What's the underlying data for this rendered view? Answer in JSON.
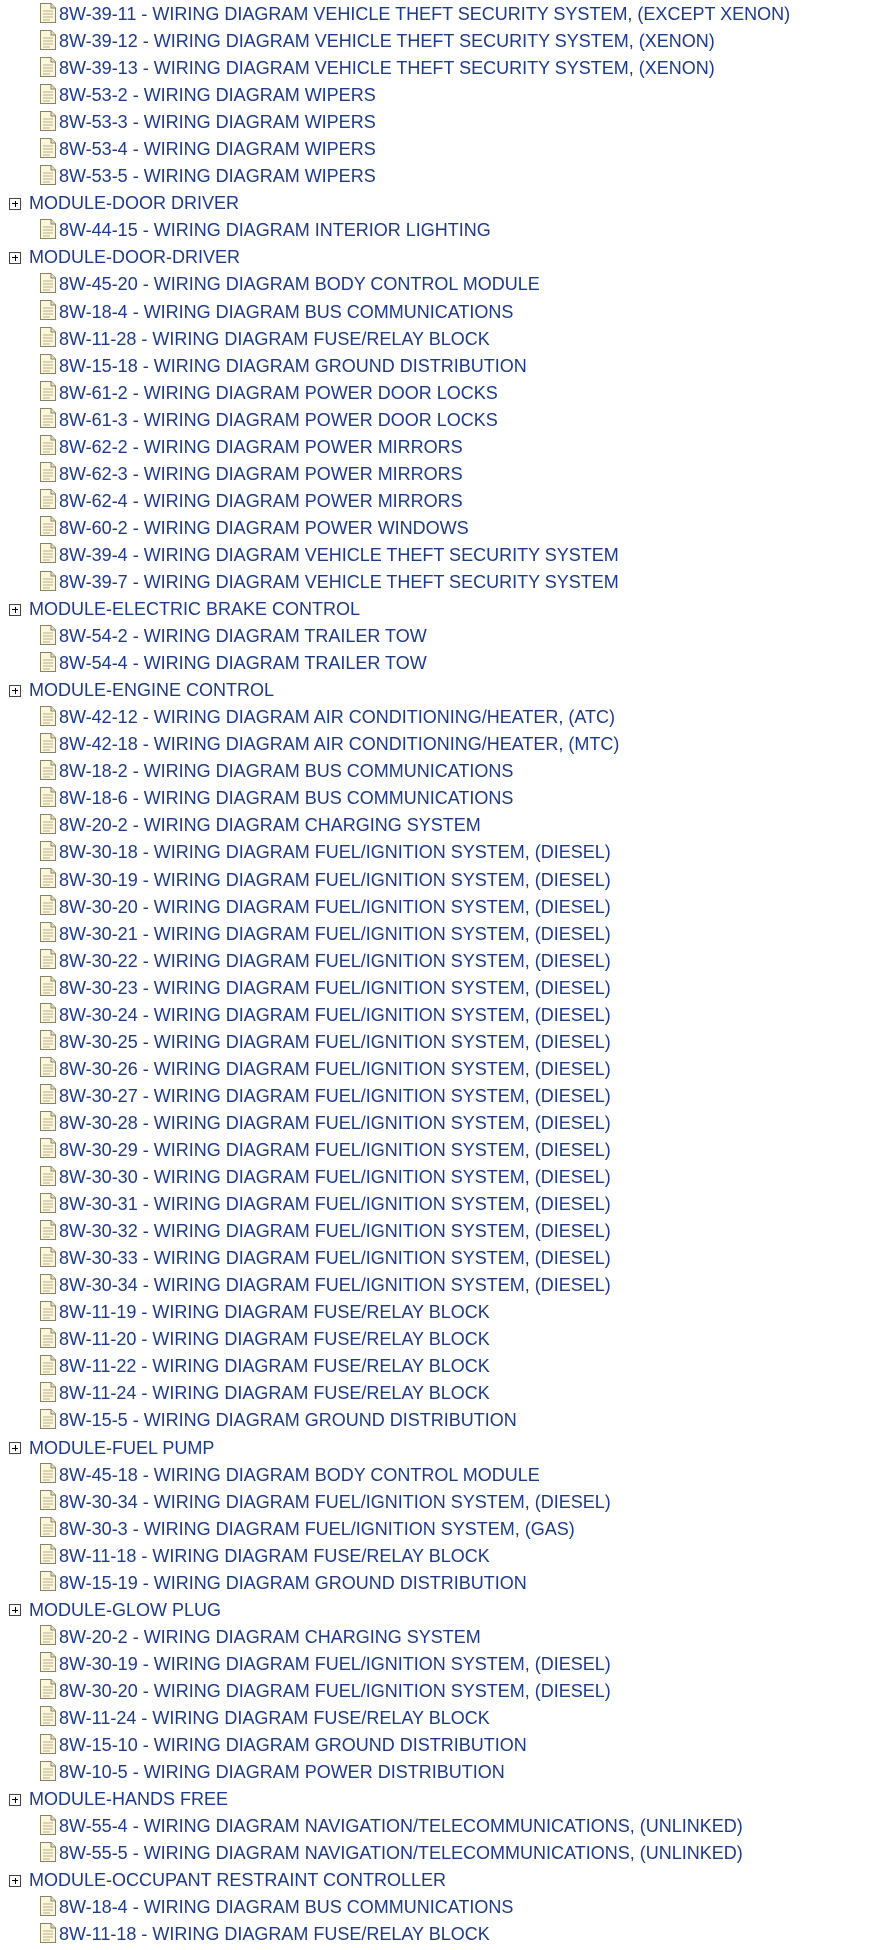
{
  "tree": [
    {
      "type": "item",
      "label": "8W-39-11 - WIRING DIAGRAM VEHICLE THEFT SECURITY SYSTEM, (EXCEPT XENON)"
    },
    {
      "type": "item",
      "label": "8W-39-12 - WIRING DIAGRAM VEHICLE THEFT SECURITY SYSTEM, (XENON)"
    },
    {
      "type": "item",
      "label": "8W-39-13 - WIRING DIAGRAM VEHICLE THEFT SECURITY SYSTEM, (XENON)"
    },
    {
      "type": "item",
      "label": "8W-53-2 - WIRING DIAGRAM WIPERS"
    },
    {
      "type": "item",
      "label": "8W-53-3 - WIRING DIAGRAM WIPERS"
    },
    {
      "type": "item",
      "label": "8W-53-4 - WIRING DIAGRAM WIPERS"
    },
    {
      "type": "item",
      "label": "8W-53-5 - WIRING DIAGRAM WIPERS"
    },
    {
      "type": "group",
      "label": "MODULE-DOOR DRIVER"
    },
    {
      "type": "item",
      "label": "8W-44-15 - WIRING DIAGRAM INTERIOR LIGHTING"
    },
    {
      "type": "group",
      "label": "MODULE-DOOR-DRIVER"
    },
    {
      "type": "item",
      "label": "8W-45-20 - WIRING DIAGRAM BODY CONTROL MODULE"
    },
    {
      "type": "item",
      "label": "8W-18-4 - WIRING DIAGRAM BUS COMMUNICATIONS"
    },
    {
      "type": "item",
      "label": "8W-11-28 - WIRING DIAGRAM FUSE/RELAY BLOCK"
    },
    {
      "type": "item",
      "label": "8W-15-18 - WIRING DIAGRAM GROUND DISTRIBUTION"
    },
    {
      "type": "item",
      "label": "8W-61-2 - WIRING DIAGRAM POWER DOOR LOCKS"
    },
    {
      "type": "item",
      "label": "8W-61-3 - WIRING DIAGRAM POWER DOOR LOCKS"
    },
    {
      "type": "item",
      "label": "8W-62-2 - WIRING DIAGRAM POWER MIRRORS"
    },
    {
      "type": "item",
      "label": "8W-62-3 - WIRING DIAGRAM POWER MIRRORS"
    },
    {
      "type": "item",
      "label": "8W-62-4 - WIRING DIAGRAM POWER MIRRORS"
    },
    {
      "type": "item",
      "label": "8W-60-2 - WIRING DIAGRAM POWER WINDOWS"
    },
    {
      "type": "item",
      "label": "8W-39-4 - WIRING DIAGRAM VEHICLE THEFT SECURITY SYSTEM"
    },
    {
      "type": "item",
      "label": "8W-39-7 - WIRING DIAGRAM VEHICLE THEFT SECURITY SYSTEM"
    },
    {
      "type": "group",
      "label": "MODULE-ELECTRIC BRAKE CONTROL"
    },
    {
      "type": "item",
      "label": "8W-54-2 - WIRING DIAGRAM TRAILER TOW"
    },
    {
      "type": "item",
      "label": "8W-54-4 - WIRING DIAGRAM TRAILER TOW"
    },
    {
      "type": "group",
      "label": "MODULE-ENGINE CONTROL"
    },
    {
      "type": "item",
      "label": "8W-42-12 - WIRING DIAGRAM AIR CONDITIONING/HEATER, (ATC)"
    },
    {
      "type": "item",
      "label": "8W-42-18 - WIRING DIAGRAM AIR CONDITIONING/HEATER, (MTC)"
    },
    {
      "type": "item",
      "label": "8W-18-2 - WIRING DIAGRAM BUS COMMUNICATIONS"
    },
    {
      "type": "item",
      "label": "8W-18-6 - WIRING DIAGRAM BUS COMMUNICATIONS"
    },
    {
      "type": "item",
      "label": "8W-20-2 - WIRING DIAGRAM CHARGING SYSTEM"
    },
    {
      "type": "item",
      "label": "8W-30-18 - WIRING DIAGRAM FUEL/IGNITION SYSTEM, (DIESEL)"
    },
    {
      "type": "item",
      "label": "8W-30-19 - WIRING DIAGRAM FUEL/IGNITION SYSTEM, (DIESEL)"
    },
    {
      "type": "item",
      "label": "8W-30-20 - WIRING DIAGRAM FUEL/IGNITION SYSTEM, (DIESEL)"
    },
    {
      "type": "item",
      "label": "8W-30-21 - WIRING DIAGRAM FUEL/IGNITION SYSTEM, (DIESEL)"
    },
    {
      "type": "item",
      "label": "8W-30-22 - WIRING DIAGRAM FUEL/IGNITION SYSTEM, (DIESEL)"
    },
    {
      "type": "item",
      "label": "8W-30-23 - WIRING DIAGRAM FUEL/IGNITION SYSTEM, (DIESEL)"
    },
    {
      "type": "item",
      "label": "8W-30-24 - WIRING DIAGRAM FUEL/IGNITION SYSTEM, (DIESEL)"
    },
    {
      "type": "item",
      "label": "8W-30-25 - WIRING DIAGRAM FUEL/IGNITION SYSTEM, (DIESEL)"
    },
    {
      "type": "item",
      "label": "8W-30-26 - WIRING DIAGRAM FUEL/IGNITION SYSTEM, (DIESEL)"
    },
    {
      "type": "item",
      "label": "8W-30-27 - WIRING DIAGRAM FUEL/IGNITION SYSTEM, (DIESEL)"
    },
    {
      "type": "item",
      "label": "8W-30-28 - WIRING DIAGRAM FUEL/IGNITION SYSTEM, (DIESEL)"
    },
    {
      "type": "item",
      "label": "8W-30-29 - WIRING DIAGRAM FUEL/IGNITION SYSTEM, (DIESEL)"
    },
    {
      "type": "item",
      "label": "8W-30-30 - WIRING DIAGRAM FUEL/IGNITION SYSTEM, (DIESEL)"
    },
    {
      "type": "item",
      "label": "8W-30-31 - WIRING DIAGRAM FUEL/IGNITION SYSTEM, (DIESEL)"
    },
    {
      "type": "item",
      "label": "8W-30-32 - WIRING DIAGRAM FUEL/IGNITION SYSTEM, (DIESEL)"
    },
    {
      "type": "item",
      "label": "8W-30-33 - WIRING DIAGRAM FUEL/IGNITION SYSTEM, (DIESEL)"
    },
    {
      "type": "item",
      "label": "8W-30-34 - WIRING DIAGRAM FUEL/IGNITION SYSTEM, (DIESEL)"
    },
    {
      "type": "item",
      "label": "8W-11-19 - WIRING DIAGRAM FUSE/RELAY BLOCK"
    },
    {
      "type": "item",
      "label": "8W-11-20 - WIRING DIAGRAM FUSE/RELAY BLOCK"
    },
    {
      "type": "item",
      "label": "8W-11-22 - WIRING DIAGRAM FUSE/RELAY BLOCK"
    },
    {
      "type": "item",
      "label": "8W-11-24 - WIRING DIAGRAM FUSE/RELAY BLOCK"
    },
    {
      "type": "item",
      "label": "8W-15-5 - WIRING DIAGRAM GROUND DISTRIBUTION"
    },
    {
      "type": "group",
      "label": "MODULE-FUEL PUMP"
    },
    {
      "type": "item",
      "label": "8W-45-18 - WIRING DIAGRAM BODY CONTROL MODULE"
    },
    {
      "type": "item",
      "label": "8W-30-34 - WIRING DIAGRAM FUEL/IGNITION SYSTEM, (DIESEL)"
    },
    {
      "type": "item",
      "label": "8W-30-3 - WIRING DIAGRAM FUEL/IGNITION SYSTEM, (GAS)"
    },
    {
      "type": "item",
      "label": "8W-11-18 - WIRING DIAGRAM FUSE/RELAY BLOCK"
    },
    {
      "type": "item",
      "label": "8W-15-19 - WIRING DIAGRAM GROUND DISTRIBUTION"
    },
    {
      "type": "group",
      "label": "MODULE-GLOW PLUG"
    },
    {
      "type": "item",
      "label": "8W-20-2 - WIRING DIAGRAM CHARGING SYSTEM"
    },
    {
      "type": "item",
      "label": "8W-30-19 - WIRING DIAGRAM FUEL/IGNITION SYSTEM, (DIESEL)"
    },
    {
      "type": "item",
      "label": "8W-30-20 - WIRING DIAGRAM FUEL/IGNITION SYSTEM, (DIESEL)"
    },
    {
      "type": "item",
      "label": "8W-11-24 - WIRING DIAGRAM FUSE/RELAY BLOCK"
    },
    {
      "type": "item",
      "label": "8W-15-10 - WIRING DIAGRAM GROUND DISTRIBUTION"
    },
    {
      "type": "item",
      "label": "8W-10-5 - WIRING DIAGRAM POWER DISTRIBUTION"
    },
    {
      "type": "group",
      "label": "MODULE-HANDS FREE"
    },
    {
      "type": "item",
      "label": "8W-55-4 - WIRING DIAGRAM NAVIGATION/TELECOMMUNICATIONS, (UNLINKED)"
    },
    {
      "type": "item",
      "label": "8W-55-5 - WIRING DIAGRAM NAVIGATION/TELECOMMUNICATIONS, (UNLINKED)"
    },
    {
      "type": "group",
      "label": "MODULE-OCCUPANT RESTRAINT CONTROLLER"
    },
    {
      "type": "item",
      "label": "8W-18-4 - WIRING DIAGRAM BUS COMMUNICATIONS"
    },
    {
      "type": "item",
      "label": "8W-11-18 - WIRING DIAGRAM FUSE/RELAY BLOCK"
    }
  ]
}
